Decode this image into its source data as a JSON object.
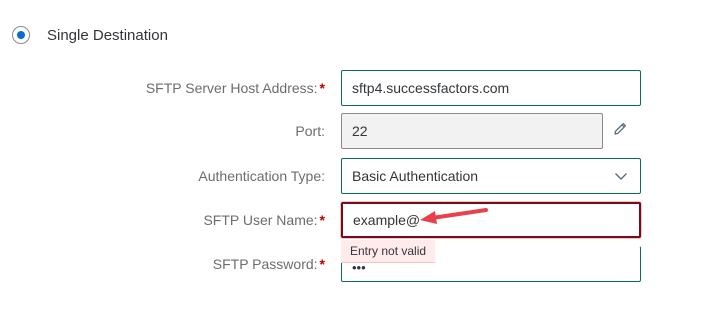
{
  "destination": {
    "label": "Single Destination",
    "selected": true
  },
  "form": {
    "host": {
      "label": "SFTP Server Host Address:",
      "required": "*",
      "value": "sftp4.successfactors.com"
    },
    "port": {
      "label": "Port:",
      "value": "22"
    },
    "auth_type": {
      "label": "Authentication Type:",
      "value": "Basic Authentication"
    },
    "user_name": {
      "label": "SFTP User Name:",
      "required": "*",
      "value": "example@",
      "error": "Entry not valid"
    },
    "password": {
      "label": "SFTP Password:",
      "required": "*",
      "value": "•••"
    }
  },
  "icons": {
    "edit": "pencil-icon",
    "dropdown": "chevron-down-icon",
    "annotation": "red-arrow"
  },
  "colors": {
    "accent": "#0a6ed1",
    "field_border": "#0a6e4e",
    "error_border": "#7d0a16",
    "error_bg": "#ffebeb",
    "required": "#bb0000",
    "annotation_arrow": "#e8414a"
  }
}
